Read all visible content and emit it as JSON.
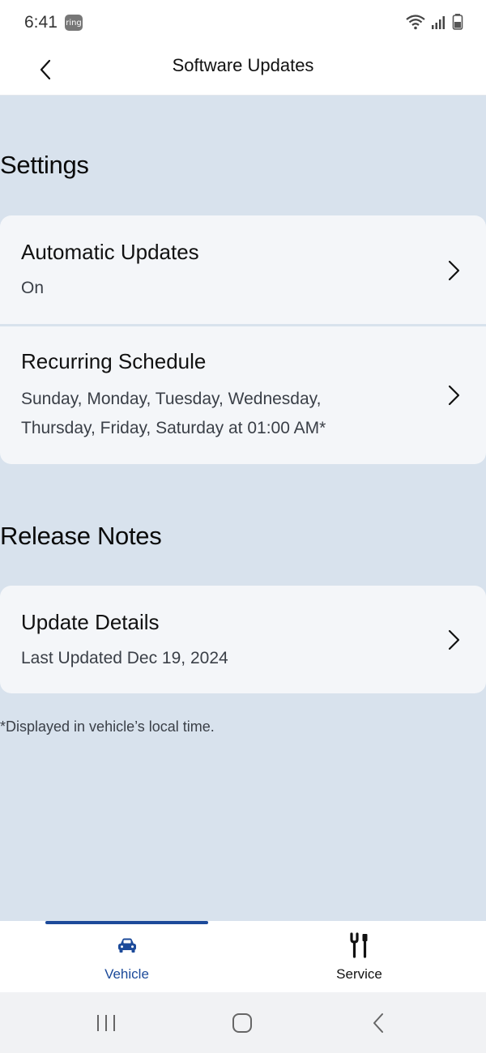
{
  "status_bar": {
    "time": "6:41",
    "ring_badge": "ring"
  },
  "header": {
    "title": "Software Updates"
  },
  "settings": {
    "title": "Settings",
    "rows": [
      {
        "title": "Automatic Updates",
        "subtitle": "On"
      },
      {
        "title": "Recurring Schedule",
        "subtitle": "Sunday, Monday, Tuesday, Wednesday, Thursday, Friday, Saturday at 01:00 AM*"
      }
    ]
  },
  "release_notes": {
    "title": "Release Notes",
    "rows": [
      {
        "title": "Update Details",
        "subtitle": "Last Updated Dec 19, 2024"
      }
    ]
  },
  "footnote": "*Displayed in vehicle’s local time.",
  "tabs": [
    {
      "label": "Vehicle",
      "icon": "car-icon",
      "active": true
    },
    {
      "label": "Service",
      "icon": "tools-icon",
      "active": false
    }
  ],
  "colors": {
    "accent": "#1c4a9a",
    "background": "#d8e2ed",
    "card": "#f4f6f9"
  }
}
